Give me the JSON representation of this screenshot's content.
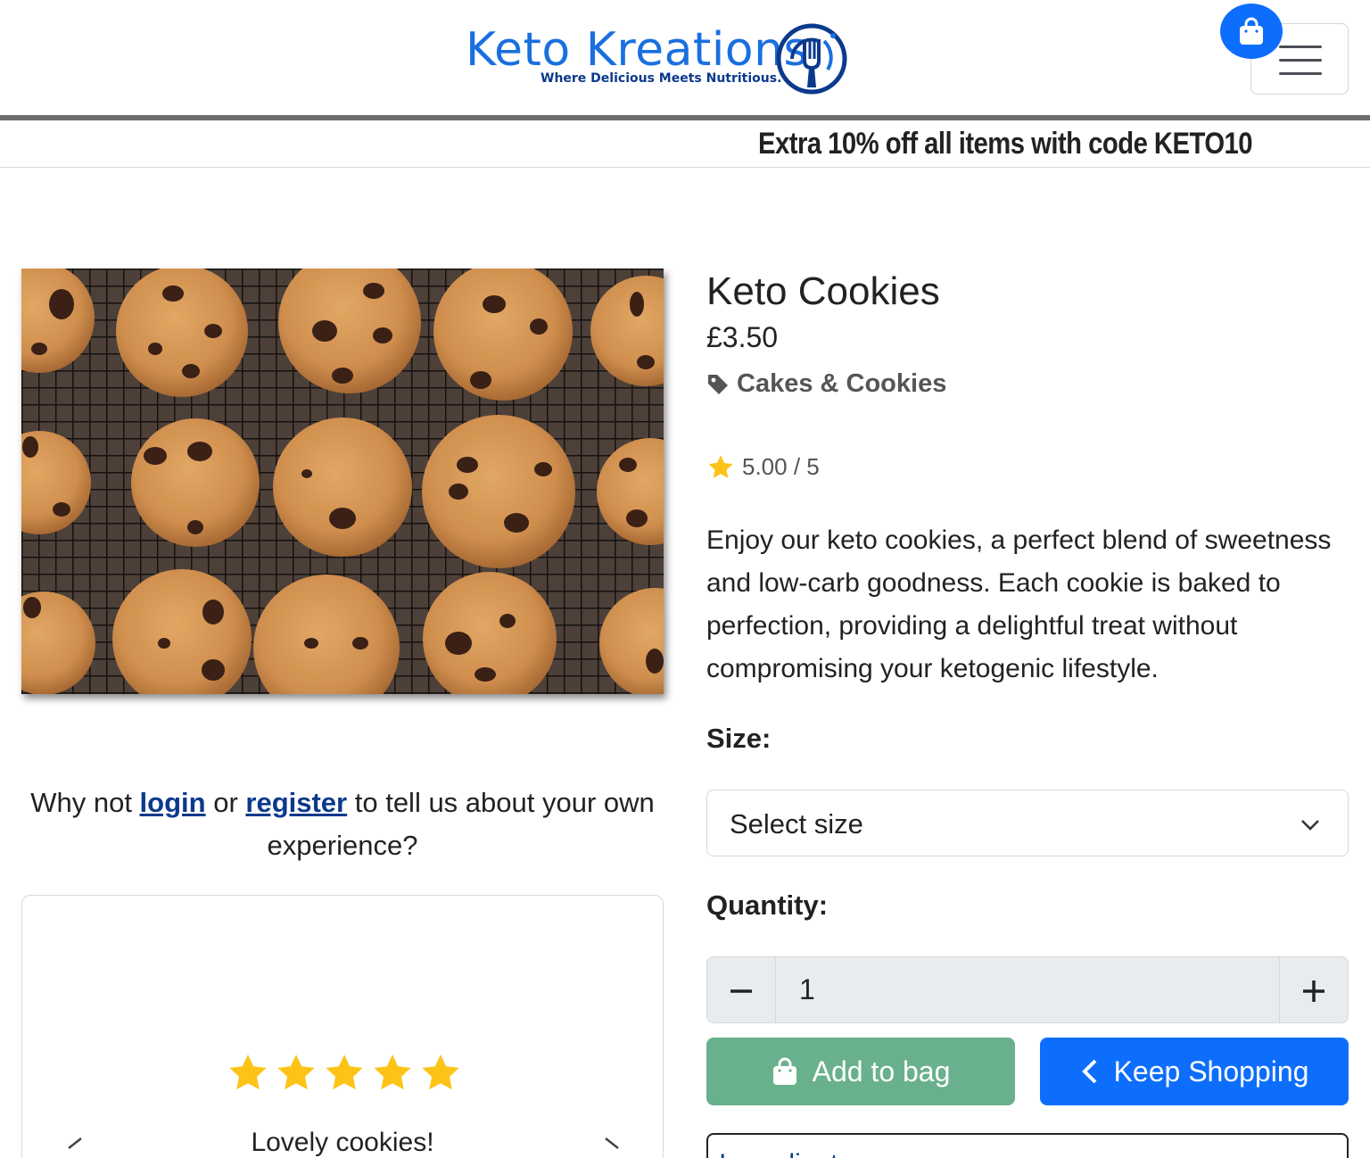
{
  "brand": {
    "name": "Keto Kreations",
    "tagline": "Where Delicious Meets Nutritious.",
    "primary_color": "#0d6efd",
    "logo_color": "#1a6fe0"
  },
  "header": {
    "bag_icon": "shopping-bag-icon",
    "menu_icon": "hamburger-menu-icon"
  },
  "promo": {
    "text": "Extra 10% off all items with code KETO10"
  },
  "product": {
    "title": "Keto Cookies",
    "price": "£3.50",
    "category": "Cakes & Cookies",
    "category_icon": "tag-icon",
    "rating": "5.00 / 5",
    "rating_value": 5,
    "rating_max": 5,
    "description": "Enjoy our keto cookies, a perfect blend of sweetness and low-carb goodness. Each cookie is baked to perfection, providing a delightful treat without compromising your ketogenic lifestyle.",
    "image": "chocolate-chip-cookies-photo"
  },
  "review_cta": {
    "prefix": "Why not ",
    "login": "login",
    "middle": " or ",
    "register": "register",
    "suffix": " to tell us about your own experience?"
  },
  "review": {
    "stars": 5,
    "title": "Lovely cookies!"
  },
  "form": {
    "size_label": "Size:",
    "size_selected": "Select size",
    "quantity_label": "Quantity:",
    "quantity_value": "1"
  },
  "buttons": {
    "add_to_bag": "Add to bag",
    "keep_shopping": "Keep Shopping",
    "add_color": "#69b18c",
    "keep_color": "#0d6efd"
  },
  "accordion": {
    "label": "Ingredients"
  }
}
